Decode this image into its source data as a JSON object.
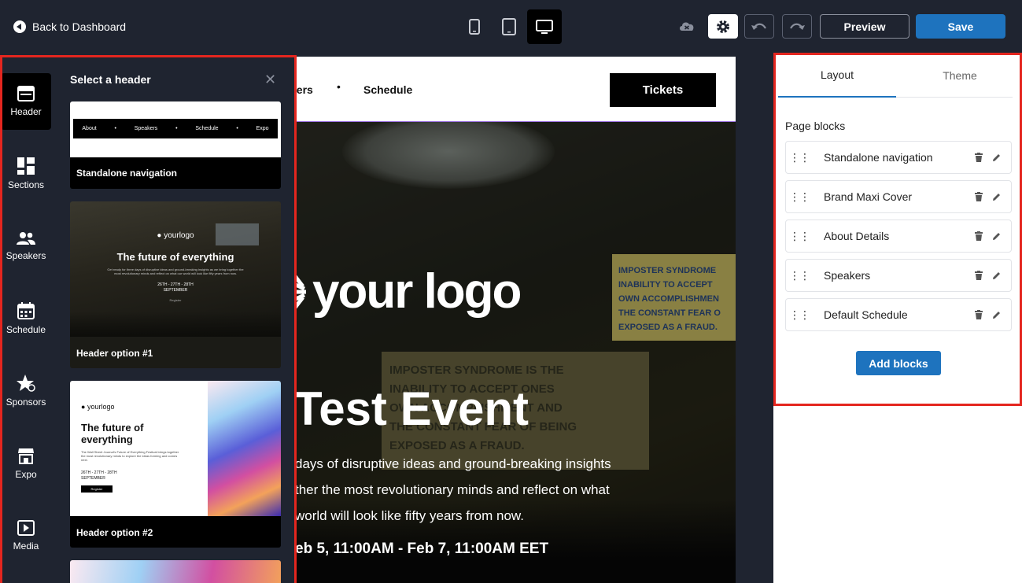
{
  "topbar": {
    "back_label": "Back to Dashboard",
    "preview_label": "Preview",
    "save_label": "Save",
    "devices": [
      "mobile-icon",
      "tablet-icon",
      "desktop-icon"
    ],
    "active_device": "desktop"
  },
  "rail": {
    "items": [
      {
        "label": "Header",
        "icon": "header-icon",
        "active": true
      },
      {
        "label": "Sections",
        "icon": "sections-icon"
      },
      {
        "label": "Speakers",
        "icon": "speakers-icon"
      },
      {
        "label": "Schedule",
        "icon": "calendar-icon"
      },
      {
        "label": "Sponsors",
        "icon": "sponsors-icon"
      },
      {
        "label": "Expo",
        "icon": "expo-icon"
      },
      {
        "label": "Media",
        "icon": "media-icon"
      }
    ]
  },
  "picker": {
    "title": "Select a header",
    "cards": [
      {
        "label": "Standalone navigation",
        "nav_items": [
          "About",
          "Speakers",
          "Schedule",
          "Expo"
        ]
      },
      {
        "label": "Header option #1",
        "logo": "yourlogo",
        "heading": "The future of everything",
        "body": "Get ready for three days of disruptive ideas and ground-breaking insights as we bring together the most revolutionary minds and reflect on what our world will look like fifty years from now.",
        "date": "26TH - 27TH - 28TH",
        "month": "SEPTEMBER",
        "cta": "Register"
      },
      {
        "label": "Header option #2",
        "logo": "yourlogo",
        "heading": "The future of everything",
        "body": "The Wall Street Journal's Future of Everything Festival brings together the most revolutionary minds to explore the ideas forming and comes next.",
        "date": "26TH - 27TH - 28TH",
        "month": "SEPTEMBER",
        "cta": "Register"
      }
    ]
  },
  "canvas": {
    "nav_partial": "kers",
    "nav_schedule": "Schedule",
    "tickets_label": "Tickets",
    "logo_text": "your logo",
    "title_partial": "Test Event",
    "desc_lines": [
      "days of disruptive ideas and ground-breaking insights",
      "ther the most revolutionary minds and reflect on what",
      "world will look like fifty years from now."
    ],
    "date_partial": "eb 5, 11:00AM - Feb 7, 11:00AM EET",
    "screen_lines": [
      "IMPOSTER SYNDROME",
      "INABILITY TO ACCEPT",
      "OWN ACCOMPLISHMEN",
      "THE CONSTANT FEAR O",
      "EXPOSED AS A FRAUD."
    ],
    "screen2_lines": [
      "IMPOSTER SYNDROME IS THE",
      "INABILITY TO ACCEPT ONES",
      "OWN ACCOMPLISHMENT AND",
      "THE CONSTANT FEAR OF BEING",
      "EXPOSED AS A FRAUD."
    ]
  },
  "panel": {
    "tabs": [
      "Layout",
      "Theme"
    ],
    "active_tab": "Layout",
    "section_title": "Page blocks",
    "blocks": [
      "Standalone navigation",
      "Brand Maxi Cover",
      "About Details",
      "Speakers",
      "Default Schedule"
    ],
    "add_label": "Add blocks"
  },
  "colors": {
    "topbar_bg": "#1f2430",
    "primary": "#1e73be",
    "highlight_frame": "#e4261f"
  }
}
